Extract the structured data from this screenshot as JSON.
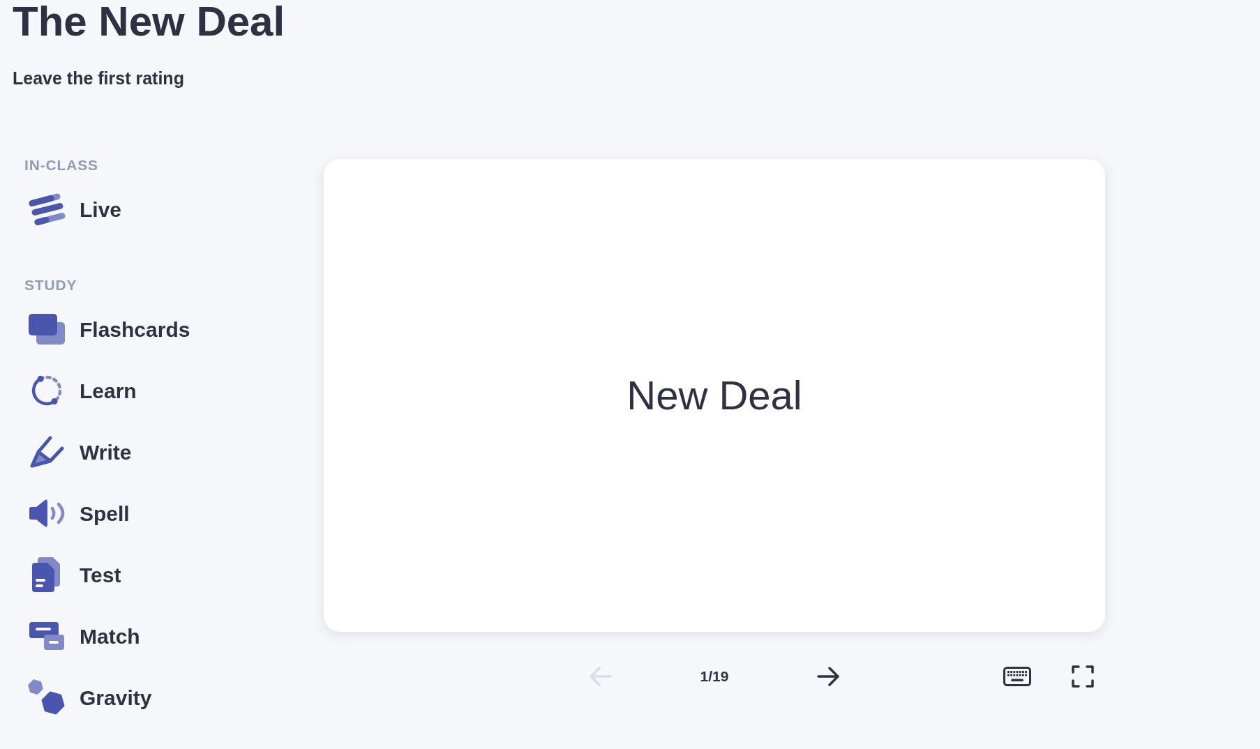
{
  "header": {
    "title": "The New Deal",
    "rating_link": "Leave the first rating"
  },
  "sidebar": {
    "sections": [
      {
        "heading": "IN-CLASS",
        "items": [
          {
            "kind": "live",
            "label": "Live"
          }
        ]
      },
      {
        "heading": "STUDY",
        "items": [
          {
            "kind": "flashcards",
            "label": "Flashcards"
          },
          {
            "kind": "learn",
            "label": "Learn"
          },
          {
            "kind": "write",
            "label": "Write"
          },
          {
            "kind": "spell",
            "label": "Spell"
          },
          {
            "kind": "test",
            "label": "Test"
          },
          {
            "kind": "match",
            "label": "Match"
          },
          {
            "kind": "gravity",
            "label": "Gravity"
          }
        ]
      }
    ]
  },
  "flashcard": {
    "term": "New Deal"
  },
  "controls": {
    "previous": {
      "disabled": true
    },
    "counter": "1/19",
    "next": {
      "disabled": false
    }
  }
}
